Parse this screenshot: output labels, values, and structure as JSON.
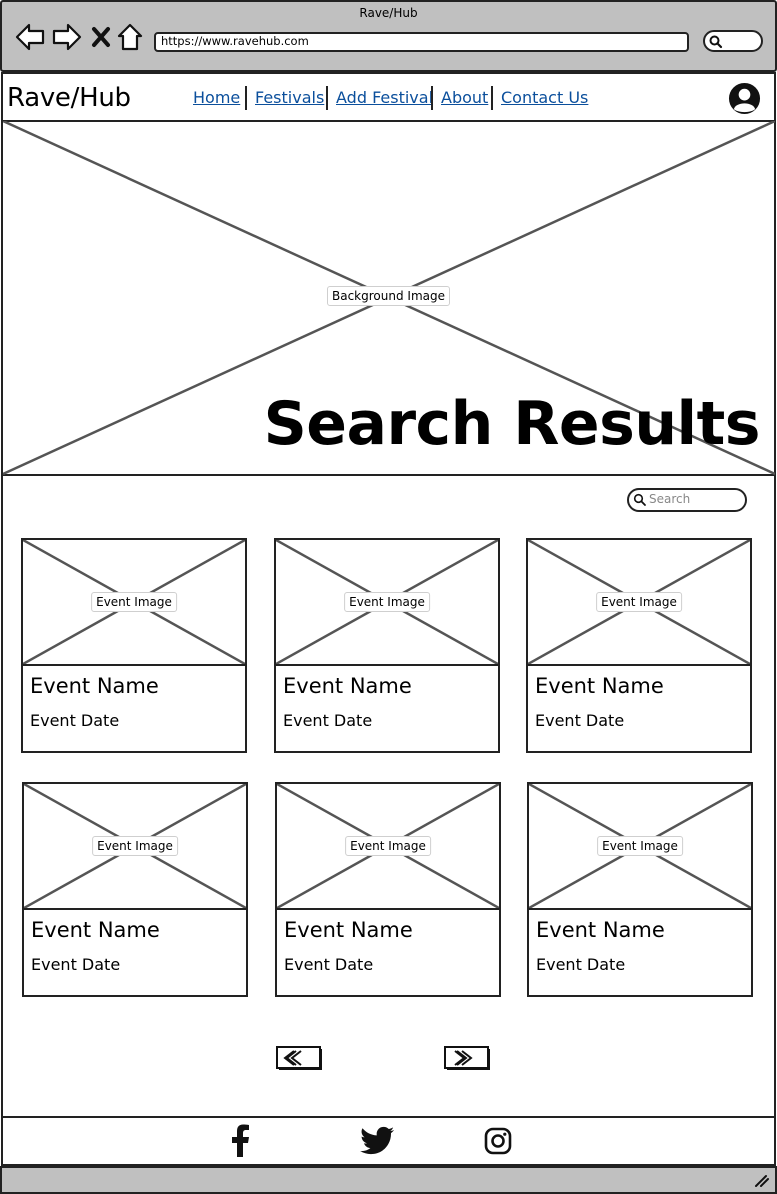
{
  "browser": {
    "window_title": "Rave/Hub",
    "url": "https://www.ravehub.com",
    "icons": [
      "back-arrow-icon",
      "forward-arrow-icon",
      "close-x-icon",
      "home-icon",
      "search-icon"
    ]
  },
  "header": {
    "logo": "Rave/Hub",
    "nav": [
      "Home",
      "Festivals",
      "Add Festival",
      "About",
      "Contact Us"
    ],
    "account_icon": "user-avatar-icon"
  },
  "hero": {
    "image_label": "Background Image",
    "title": "Search Results"
  },
  "search": {
    "placeholder": "Search",
    "icon": "search-icon"
  },
  "events": [
    {
      "image_label": "Event Image",
      "name": "Event Name",
      "date": "Event Date"
    },
    {
      "image_label": "Event Image",
      "name": "Event Name",
      "date": "Event Date"
    },
    {
      "image_label": "Event Image",
      "name": "Event Name",
      "date": "Event Date"
    },
    {
      "image_label": "Event Image",
      "name": "Event Name",
      "date": "Event Date"
    },
    {
      "image_label": "Event Image",
      "name": "Event Name",
      "date": "Event Date"
    },
    {
      "image_label": "Event Image",
      "name": "Event Name",
      "date": "Event Date"
    }
  ],
  "pagination": {
    "prev_icon": "double-chevron-left-icon",
    "next_icon": "double-chevron-right-icon"
  },
  "footer": {
    "social_icons": [
      "facebook-icon",
      "twitter-icon",
      "instagram-icon"
    ]
  },
  "colors": {
    "link": "#0b4f9c",
    "chrome": "#c0c0c0",
    "stroke": "#222222"
  }
}
